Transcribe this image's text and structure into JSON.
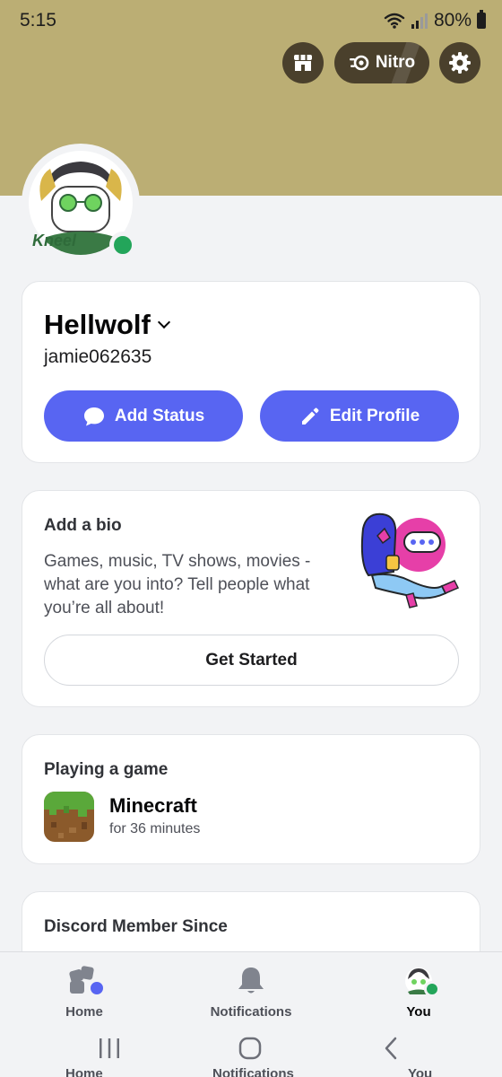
{
  "status_bar": {
    "time": "5:15",
    "battery": "80%"
  },
  "top_actions": {
    "nitro_label": "Nitro"
  },
  "avatar": {
    "caption": "Kneel"
  },
  "profile": {
    "display_name": "Hellwolf",
    "username": "jamie062635",
    "add_status_label": "Add Status",
    "edit_profile_label": "Edit Profile"
  },
  "bio": {
    "title": "Add a bio",
    "prompt": "Games, music, TV shows, movies - what are you into? Tell people what you’re all about!",
    "button_label": "Get Started"
  },
  "activity": {
    "title": "Playing a game",
    "game_name": "Minecraft",
    "duration": "for 36 minutes"
  },
  "member": {
    "title": "Discord Member Since"
  },
  "bottom_nav": {
    "home": "Home",
    "notifications": "Notifications",
    "you": "You"
  },
  "colors": {
    "banner": "#bbae74",
    "blurple": "#5865f2",
    "online": "#23a55a"
  },
  "icons": [
    "shop-icon",
    "nitro-icon",
    "gear-icon",
    "chat-bubble-icon",
    "pencil-icon",
    "home-icon",
    "bell-icon"
  ]
}
